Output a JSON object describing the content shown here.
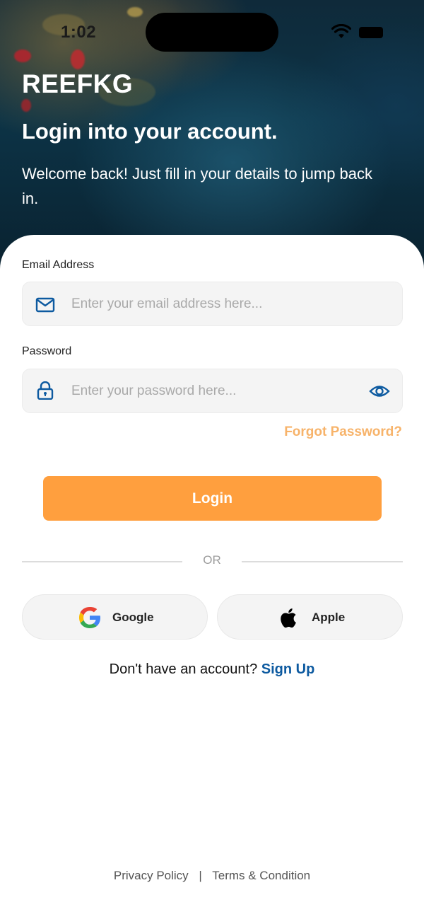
{
  "status_bar": {
    "time": "1:02"
  },
  "header": {
    "brand": "REEFKG",
    "title": "Login into your account.",
    "subtitle": "Welcome back! Just fill in your details to jump back in."
  },
  "form": {
    "email": {
      "label": "Email Address",
      "placeholder": "Enter your email address here..."
    },
    "password": {
      "label": "Password",
      "placeholder": "Enter your password here..."
    },
    "forgot_label": "Forgot Password?",
    "login_label": "Login"
  },
  "divider": {
    "label": "OR"
  },
  "social": {
    "google_label": "Google",
    "apple_label": "Apple"
  },
  "signup": {
    "prompt": "Don't have an account?",
    "link_label": "Sign Up"
  },
  "footer": {
    "privacy": "Privacy Policy",
    "separator": "|",
    "terms": "Terms & Condition"
  },
  "colors": {
    "accent": "#ff9f3e",
    "link": "#0d5aa0",
    "forgot": "#f7b36a",
    "icon": "#0d5aa0"
  }
}
